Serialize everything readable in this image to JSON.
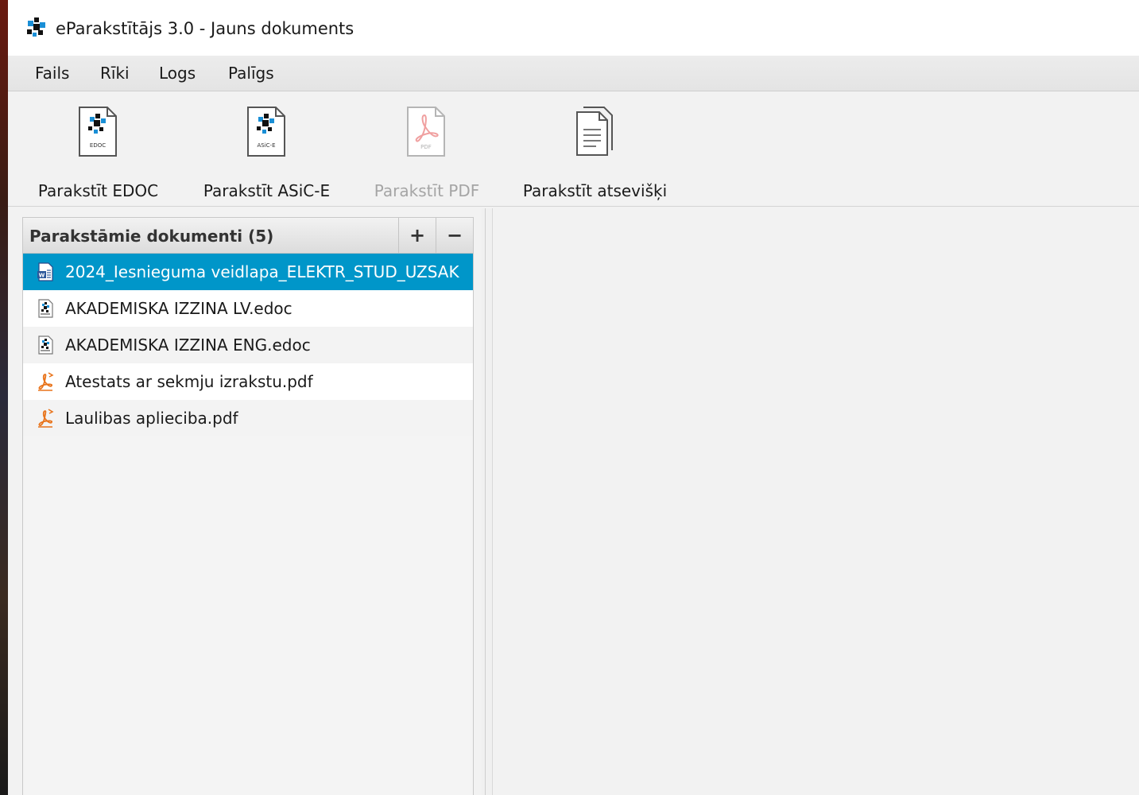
{
  "window": {
    "title": "eParakstītājs 3.0 - Jauns dokuments"
  },
  "menu": {
    "items": [
      {
        "label": "Fails"
      },
      {
        "label": "Rīki"
      },
      {
        "label": "Logs"
      },
      {
        "label": "Palīgs"
      }
    ]
  },
  "toolbar": {
    "buttons": [
      {
        "label": "Parakstīt EDOC",
        "icon": "edoc-file-icon",
        "enabled": true,
        "icon_text": "EDOC"
      },
      {
        "label": "Parakstīt ASiC-E",
        "icon": "asice-file-icon",
        "enabled": true,
        "icon_text": "ASiC-E"
      },
      {
        "label": "Parakstīt PDF",
        "icon": "pdf-file-icon",
        "enabled": false,
        "icon_text": "PDF"
      },
      {
        "label": "Parakstīt atsevišķi",
        "icon": "documents-stack-icon",
        "enabled": true
      }
    ]
  },
  "documents_panel": {
    "title": "Parakstāmie dokumenti (5)",
    "add_label": "+",
    "remove_label": "−",
    "items": [
      {
        "name": "2024_Iesnieguma veidlapa_ELEKTR_STUD_UZSAK",
        "icon": "word-document-icon",
        "selected": true
      },
      {
        "name": "AKADEMISKA IZZINA LV.edoc",
        "icon": "edoc-document-icon",
        "selected": false
      },
      {
        "name": "AKADEMISKA IZZINA ENG.edoc",
        "icon": "edoc-document-icon",
        "selected": false
      },
      {
        "name": "Atestats ar sekmju izrakstu.pdf",
        "icon": "pdf-document-icon",
        "selected": false
      },
      {
        "name": "Laulibas aplieciba.pdf",
        "icon": "pdf-document-icon",
        "selected": false
      }
    ]
  },
  "colors": {
    "selection": "#0096c9",
    "pdf_accent": "#e8731a",
    "logo_blue": "#1a8fd6"
  }
}
